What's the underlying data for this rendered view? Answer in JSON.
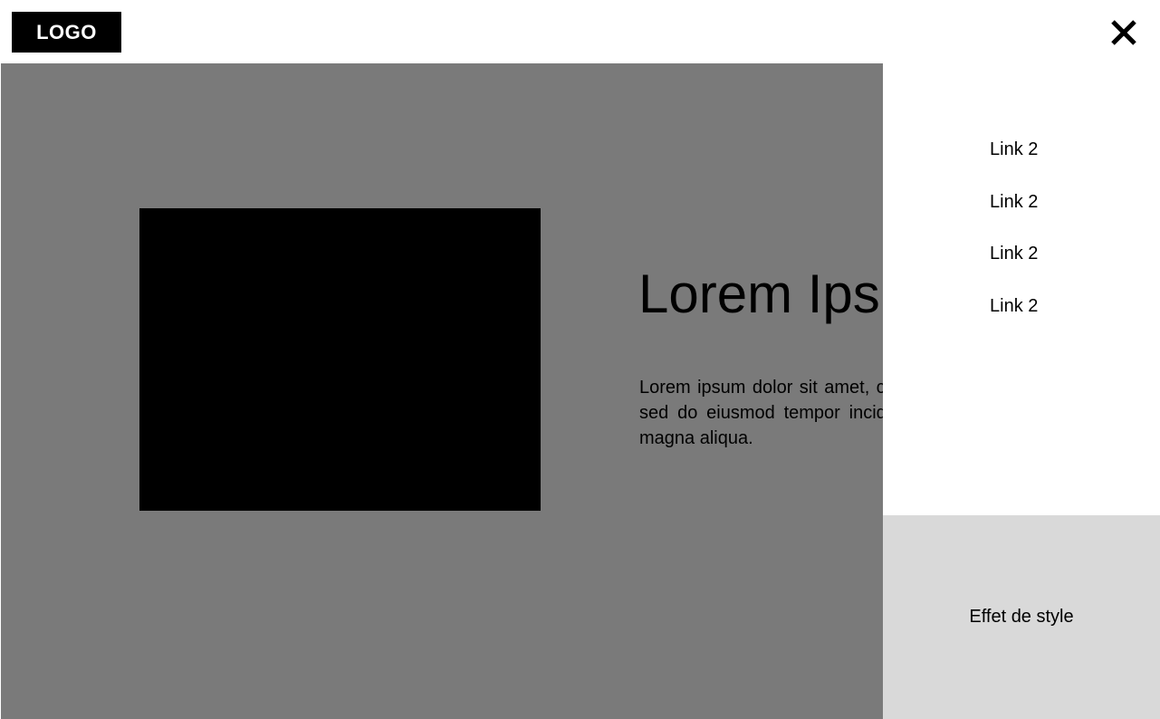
{
  "header": {
    "logo_text": "LOGO",
    "close_icon": "close-icon"
  },
  "hero": {
    "title": "Lorem Ipsum",
    "body": "Lorem ipsum dolor sit amet, consectetur adipiscing elit, sed do eiusmod tempor incididunt ut labore et dolore magna aliqua."
  },
  "menu": {
    "links": [
      {
        "label": "Link 2"
      },
      {
        "label": "Link 2"
      },
      {
        "label": "Link 2"
      },
      {
        "label": "Link 2"
      }
    ],
    "style_effect_label": "Effet de style"
  },
  "colors": {
    "overlay": "#7a7a7a",
    "image_placeholder": "#000000",
    "menu_background": "#ffffff",
    "style_effect_background": "#d9d9d9"
  }
}
